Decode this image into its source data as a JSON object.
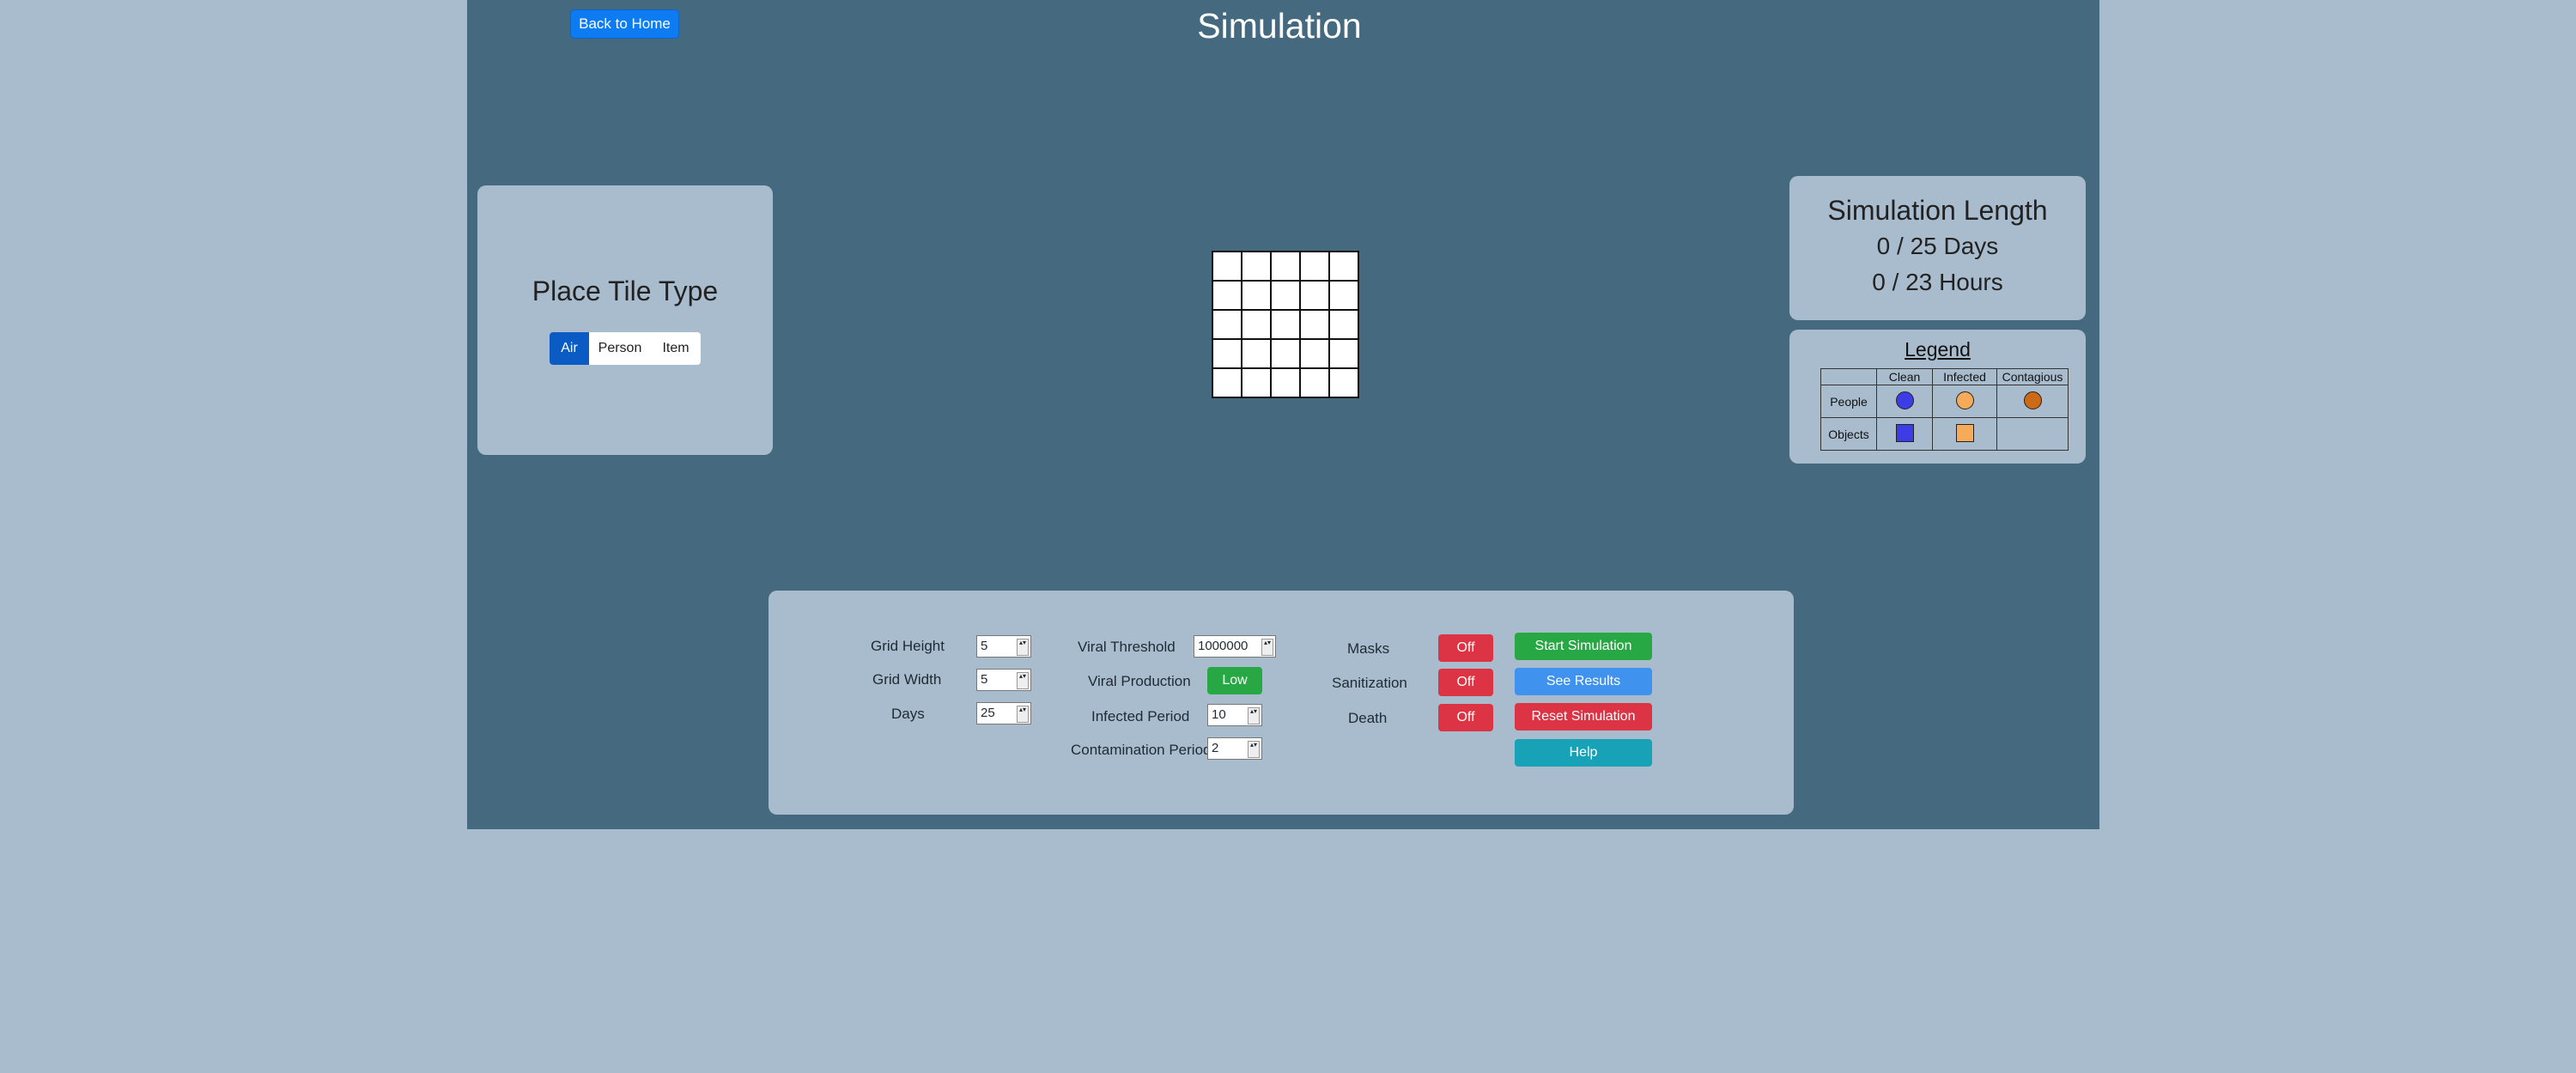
{
  "header": {
    "back_label": "Back to Home",
    "title": "Simulation"
  },
  "tile_panel": {
    "title": "Place Tile Type",
    "options": [
      "Air",
      "Person",
      "Item"
    ],
    "selected": "Air"
  },
  "grid": {
    "rows": 5,
    "cols": 5
  },
  "length_panel": {
    "title": "Simulation Length",
    "days_text": "0 / 25 Days",
    "hours_text": "0 / 23 Hours"
  },
  "legend": {
    "title": "Legend",
    "columns": [
      "Clean",
      "Infected",
      "Contagious"
    ],
    "rows": [
      "People",
      "Objects"
    ],
    "colors": {
      "clean": "#3d3de8",
      "infected": "#f7aa58",
      "contagious": "#cc6a16"
    }
  },
  "controls": {
    "grid_height_label": "Grid Height",
    "grid_height": "5",
    "grid_width_label": "Grid Width",
    "grid_width": "5",
    "days_label": "Days",
    "days": "25",
    "viral_threshold_label": "Viral Threshold",
    "viral_threshold": "1000000",
    "viral_production_label": "Viral Production",
    "viral_production": "Low",
    "infected_period_label": "Infected Period",
    "infected_period": "10",
    "contamination_period_label": "Contamination Period",
    "contamination_period": "2",
    "masks_label": "Masks",
    "masks": "Off",
    "sanitization_label": "Sanitization",
    "sanitization": "Off",
    "death_label": "Death",
    "death": "Off",
    "start_label": "Start Simulation",
    "results_label": "See Results",
    "reset_label": "Reset Simulation",
    "help_label": "Help"
  }
}
